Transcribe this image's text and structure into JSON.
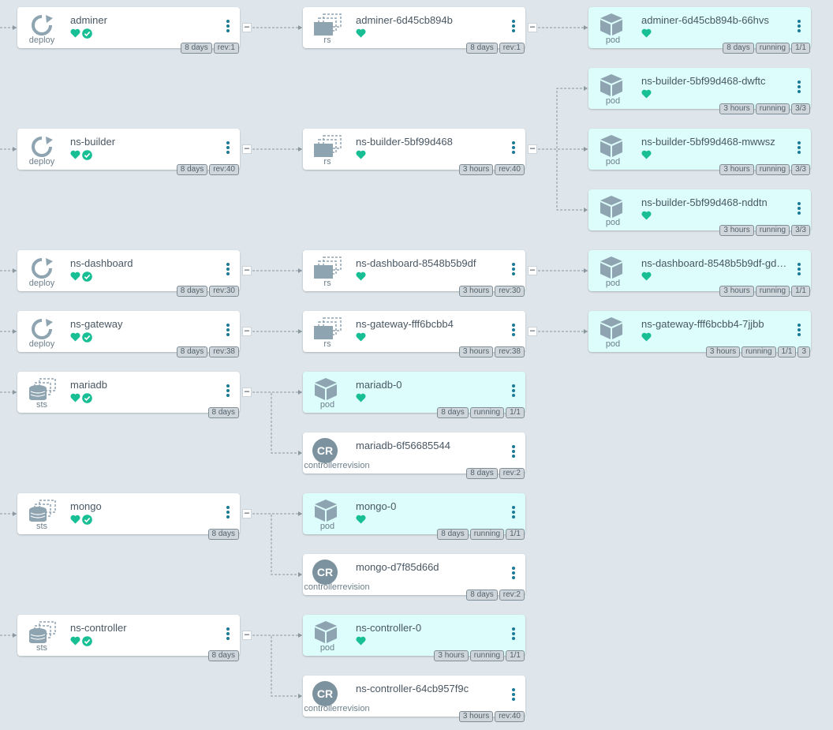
{
  "colors": {
    "background": "#dee6eb",
    "pod_background": "#dcfdfb",
    "node_background": "#ffffff",
    "healthy": "#18be94",
    "icon_gray": "#8fa4b1",
    "menu_dots": "#1a7a96",
    "edge": "#8a979f"
  },
  "collapse_symbol": "−",
  "nodes": [
    {
      "id": "n0",
      "name": "adminer",
      "kind": "deploy",
      "icon": "deploy-icon",
      "health": true,
      "synced": true,
      "tags": [
        "8 days",
        "rev:1"
      ],
      "collapse": true
    },
    {
      "id": "n1",
      "name": "adminer-6d45cb894b",
      "kind": "rs",
      "icon": "replicaset-icon",
      "health": true,
      "synced": false,
      "tags": [
        "8 days",
        "rev:1"
      ],
      "collapse": true
    },
    {
      "id": "n2",
      "name": "adminer-6d45cb894b-66hvs",
      "kind": "pod",
      "icon": "pod-icon",
      "health": true,
      "synced": false,
      "tags": [
        "8 days",
        "running",
        "1/1"
      ],
      "collapse": false
    },
    {
      "id": "n3",
      "name": "ns-builder-5bf99d468-dwftc",
      "kind": "pod",
      "icon": "pod-icon",
      "health": true,
      "synced": false,
      "tags": [
        "3 hours",
        "running",
        "3/3"
      ],
      "collapse": false
    },
    {
      "id": "n4",
      "name": "ns-builder",
      "kind": "deploy",
      "icon": "deploy-icon",
      "health": true,
      "synced": true,
      "tags": [
        "8 days",
        "rev:40"
      ],
      "collapse": true
    },
    {
      "id": "n5",
      "name": "ns-builder-5bf99d468",
      "kind": "rs",
      "icon": "replicaset-icon",
      "health": true,
      "synced": false,
      "tags": [
        "3 hours",
        "rev:40"
      ],
      "collapse": true
    },
    {
      "id": "n6",
      "name": "ns-builder-5bf99d468-mwwsz",
      "kind": "pod",
      "icon": "pod-icon",
      "health": true,
      "synced": false,
      "tags": [
        "3 hours",
        "running",
        "3/3"
      ],
      "collapse": false
    },
    {
      "id": "n7",
      "name": "ns-builder-5bf99d468-nddtn",
      "kind": "pod",
      "icon": "pod-icon",
      "health": true,
      "synced": false,
      "tags": [
        "3 hours",
        "running",
        "3/3"
      ],
      "collapse": false
    },
    {
      "id": "n8",
      "name": "ns-dashboard",
      "kind": "deploy",
      "icon": "deploy-icon",
      "health": true,
      "synced": true,
      "tags": [
        "8 days",
        "rev:30"
      ],
      "collapse": true
    },
    {
      "id": "n9",
      "name": "ns-dashboard-8548b5b9df",
      "kind": "rs",
      "icon": "replicaset-icon",
      "health": true,
      "synced": false,
      "tags": [
        "3 hours",
        "rev:30"
      ],
      "collapse": true
    },
    {
      "id": "n10",
      "name": "ns-dashboard-8548b5b9df-gd…",
      "kind": "pod",
      "icon": "pod-icon",
      "health": true,
      "synced": false,
      "tags": [
        "3 hours",
        "running",
        "1/1"
      ],
      "collapse": false
    },
    {
      "id": "n11",
      "name": "ns-gateway",
      "kind": "deploy",
      "icon": "deploy-icon",
      "health": true,
      "synced": true,
      "tags": [
        "8 days",
        "rev:38"
      ],
      "collapse": true
    },
    {
      "id": "n12",
      "name": "ns-gateway-fff6bcbb4",
      "kind": "rs",
      "icon": "replicaset-icon",
      "health": true,
      "synced": false,
      "tags": [
        "3 hours",
        "rev:38"
      ],
      "collapse": true
    },
    {
      "id": "n13",
      "name": "ns-gateway-fff6bcbb4-7jjbb",
      "kind": "pod",
      "icon": "pod-icon",
      "health": true,
      "synced": false,
      "tags": [
        "3 hours",
        "running",
        "1/1",
        "3"
      ],
      "collapse": false
    },
    {
      "id": "n14",
      "name": "mariadb",
      "kind": "sts",
      "icon": "statefulset-icon",
      "health": true,
      "synced": true,
      "tags": [
        "8 days"
      ],
      "collapse": true
    },
    {
      "id": "n15",
      "name": "mariadb-0",
      "kind": "pod",
      "icon": "pod-icon",
      "health": true,
      "synced": false,
      "tags": [
        "8 days",
        "running",
        "1/1"
      ],
      "collapse": false
    },
    {
      "id": "n16",
      "name": "mariadb-6f56685544",
      "kind": "controllerrevision",
      "icon": "controllerrevision-icon",
      "icon_text": "CR",
      "health": false,
      "synced": false,
      "tags": [
        "8 days",
        "rev:2"
      ],
      "collapse": false
    },
    {
      "id": "n17",
      "name": "mongo",
      "kind": "sts",
      "icon": "statefulset-icon",
      "health": true,
      "synced": true,
      "tags": [
        "8 days"
      ],
      "collapse": true
    },
    {
      "id": "n18",
      "name": "mongo-0",
      "kind": "pod",
      "icon": "pod-icon",
      "health": true,
      "synced": false,
      "tags": [
        "8 days",
        "running",
        "1/1"
      ],
      "collapse": false
    },
    {
      "id": "n19",
      "name": "mongo-d7f85d66d",
      "kind": "controllerrevision",
      "icon": "controllerrevision-icon",
      "icon_text": "CR",
      "health": false,
      "synced": false,
      "tags": [
        "8 days",
        "rev:2"
      ],
      "collapse": false
    },
    {
      "id": "n20",
      "name": "ns-controller",
      "kind": "sts",
      "icon": "statefulset-icon",
      "health": true,
      "synced": true,
      "tags": [
        "8 days"
      ],
      "collapse": true
    },
    {
      "id": "n21",
      "name": "ns-controller-0",
      "kind": "pod",
      "icon": "pod-icon",
      "health": true,
      "synced": false,
      "tags": [
        "3 hours",
        "running",
        "1/1"
      ],
      "collapse": false
    },
    {
      "id": "n22",
      "name": "ns-controller-64cb957f9c",
      "kind": "controllerrevision",
      "icon": "controllerrevision-icon",
      "icon_text": "CR",
      "health": false,
      "synced": false,
      "tags": [
        "3 hours",
        "rev:40"
      ],
      "collapse": false
    }
  ],
  "edges": [
    [
      "n0",
      "n1"
    ],
    [
      "n1",
      "n2"
    ],
    [
      "n4",
      "n5"
    ],
    [
      "n5",
      "n3"
    ],
    [
      "n5",
      "n6"
    ],
    [
      "n5",
      "n7"
    ],
    [
      "n8",
      "n9"
    ],
    [
      "n9",
      "n10"
    ],
    [
      "n11",
      "n12"
    ],
    [
      "n12",
      "n13"
    ],
    [
      "n14",
      "n15"
    ],
    [
      "n14",
      "n16"
    ],
    [
      "n17",
      "n18"
    ],
    [
      "n17",
      "n19"
    ],
    [
      "n20",
      "n21"
    ],
    [
      "n20",
      "n22"
    ]
  ],
  "incoming_edges": [
    "n0",
    "n4",
    "n8",
    "n11",
    "n14",
    "n17",
    "n20"
  ]
}
